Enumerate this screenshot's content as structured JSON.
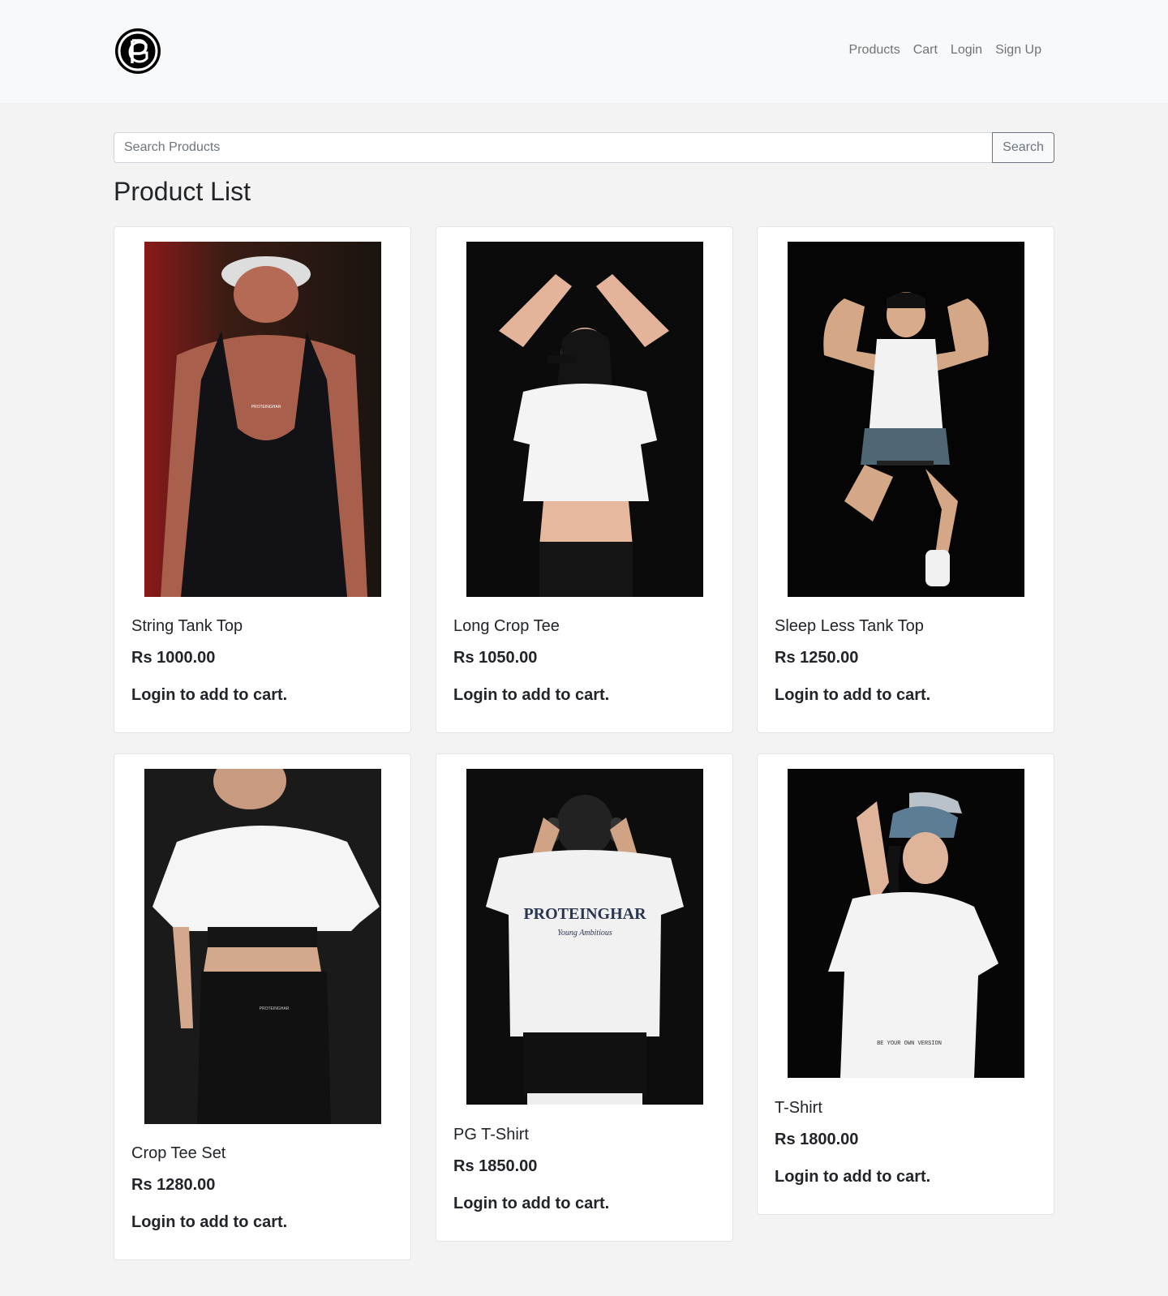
{
  "navbar": {
    "logo_alt": "PG",
    "links": [
      "Products",
      "Cart",
      "Login",
      "Sign Up"
    ]
  },
  "search": {
    "placeholder": "Search Products",
    "value": "",
    "button_label": "Search"
  },
  "page_title": "Product List",
  "products": [
    {
      "name": "String Tank Top",
      "price": "Rs 1000.00",
      "action": "Login to add to cart."
    },
    {
      "name": "Long Crop Tee",
      "price": "Rs 1050.00",
      "action": "Login to add to cart."
    },
    {
      "name": "Sleep Less Tank Top",
      "price": "Rs 1250.00",
      "action": "Login to add to cart."
    },
    {
      "name": "Crop Tee Set",
      "price": "Rs 1280.00",
      "action": "Login to add to cart."
    },
    {
      "name": "PG T-Shirt",
      "price": "Rs 1850.00",
      "action": "Login to add to cart."
    },
    {
      "name": "T-Shirt",
      "price": "Rs 1800.00",
      "action": "Login to add to cart."
    }
  ],
  "colors": {
    "navbar_bg": "#f8f9fa",
    "page_bg": "#f3f3f3",
    "text": "#212529",
    "nav_link": "#8c8c8c"
  }
}
